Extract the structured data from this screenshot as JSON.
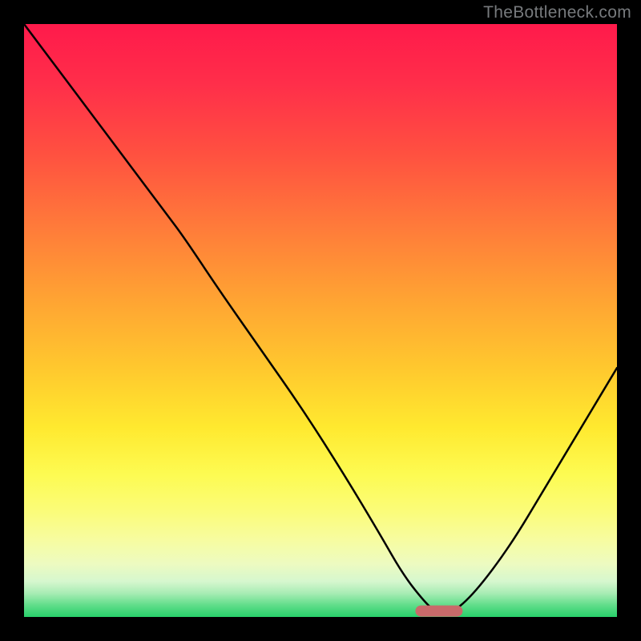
{
  "watermark": "TheBottleneck.com",
  "chart_data": {
    "type": "line",
    "title": "",
    "xlabel": "",
    "ylabel": "",
    "xlim": [
      0,
      100
    ],
    "ylim": [
      0,
      100
    ],
    "grid": false,
    "series": [
      {
        "name": "curve",
        "x": [
          0,
          6,
          12,
          18,
          24,
          27,
          33,
          40,
          47,
          54,
          60,
          64,
          68,
          70,
          72,
          76,
          82,
          88,
          94,
          100
        ],
        "y": [
          100,
          92,
          84,
          76,
          68,
          64,
          55,
          45,
          35,
          24,
          14,
          7,
          2,
          0.5,
          0.5,
          4,
          12,
          22,
          32,
          42
        ]
      }
    ],
    "marker": {
      "shape": "rounded-bar",
      "color": "#c96a6a",
      "x_center": 70,
      "y_center": 1,
      "width_x_units": 8,
      "height_y_units": 2
    },
    "background_gradient": {
      "direction": "top-to-bottom",
      "stops": [
        {
          "pos": 0,
          "color": "#ff1a4b"
        },
        {
          "pos": 10,
          "color": "#ff2e4a"
        },
        {
          "pos": 22,
          "color": "#ff5140"
        },
        {
          "pos": 34,
          "color": "#ff7a3a"
        },
        {
          "pos": 46,
          "color": "#ffa233"
        },
        {
          "pos": 58,
          "color": "#ffc82e"
        },
        {
          "pos": 68,
          "color": "#ffe92f"
        },
        {
          "pos": 76,
          "color": "#fdfb52"
        },
        {
          "pos": 82,
          "color": "#fbfc78"
        },
        {
          "pos": 87,
          "color": "#f7fca0"
        },
        {
          "pos": 91,
          "color": "#edfbc0"
        },
        {
          "pos": 94,
          "color": "#d6f7ce"
        },
        {
          "pos": 96,
          "color": "#a8ecb4"
        },
        {
          "pos": 98,
          "color": "#61dd8a"
        },
        {
          "pos": 100,
          "color": "#28d06a"
        }
      ]
    }
  }
}
